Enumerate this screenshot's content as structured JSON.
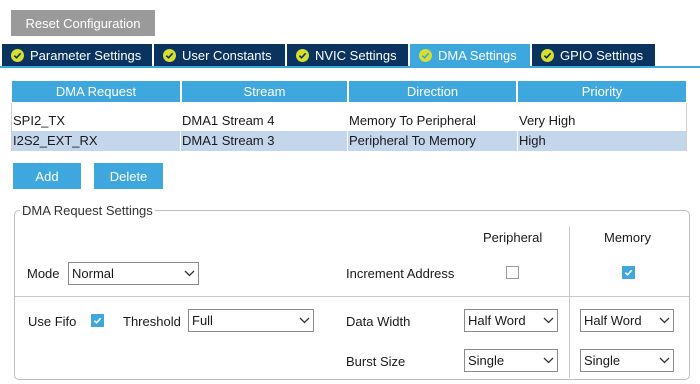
{
  "toolbar": {
    "reset_label": "Reset Configuration"
  },
  "tabs": [
    {
      "label": "Parameter Settings",
      "active": false
    },
    {
      "label": "User Constants",
      "active": false
    },
    {
      "label": "NVIC Settings",
      "active": false
    },
    {
      "label": "DMA Settings",
      "active": true
    },
    {
      "label": "GPIO Settings",
      "active": false
    }
  ],
  "table": {
    "headers": [
      "DMA Request",
      "Stream",
      "Direction",
      "Priority"
    ],
    "rows": [
      {
        "request": "SPI2_TX",
        "stream": "DMA1 Stream 4",
        "direction": "Memory To Peripheral",
        "priority": "Very High",
        "selected": false
      },
      {
        "request": "I2S2_EXT_RX",
        "stream": "DMA1 Stream 3",
        "direction": "Peripheral To Memory",
        "priority": "High",
        "selected": true
      }
    ]
  },
  "actions": {
    "add_label": "Add",
    "delete_label": "Delete"
  },
  "settings": {
    "legend": "DMA Request Settings",
    "peripheral_header": "Peripheral",
    "memory_header": "Memory",
    "mode_label": "Mode",
    "mode_value": "Normal",
    "increment_label": "Increment Address",
    "increment_peripheral": false,
    "increment_memory": true,
    "use_fifo_label": "Use Fifo",
    "use_fifo": true,
    "threshold_label": "Threshold",
    "threshold_value": "Full",
    "data_width_label": "Data Width",
    "data_width_peripheral": "Half Word",
    "data_width_memory": "Half Word",
    "burst_size_label": "Burst Size",
    "burst_size_peripheral": "Single",
    "burst_size_memory": "Single"
  },
  "colors": {
    "accent": "#3ea7dd",
    "tab_dark": "#0b3360",
    "tab_check": "#d6df2e",
    "selected_row": "#c4d6ec",
    "reset_button": "#9a9a9a"
  }
}
